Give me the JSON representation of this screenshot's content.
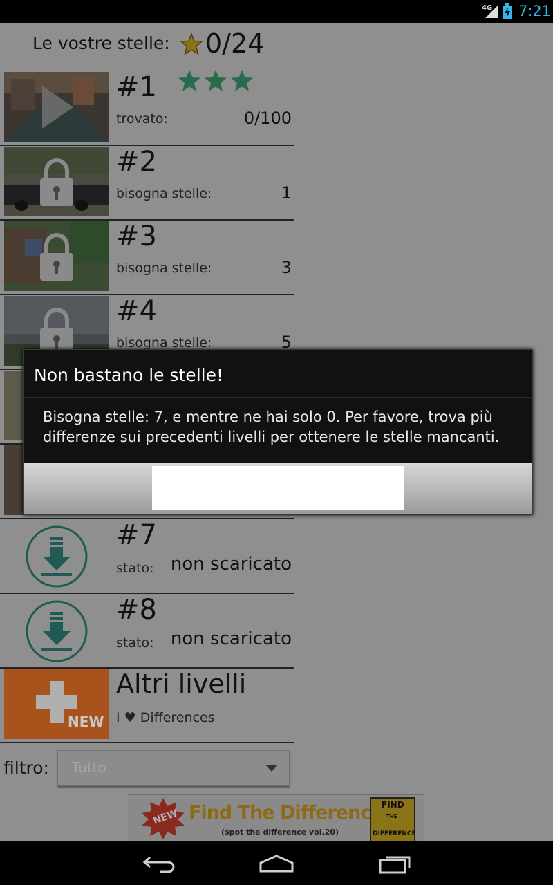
{
  "status_bar": {
    "network": "4G",
    "time": "7:21"
  },
  "header": {
    "label": "Le vostre stelle:",
    "count": "0/24"
  },
  "levels": [
    {
      "number": "#1",
      "key": "trovato:",
      "value": "0/100",
      "stars": 3,
      "state": "playable"
    },
    {
      "number": "#2",
      "key": "bisogna stelle:",
      "value": "1",
      "state": "locked"
    },
    {
      "number": "#3",
      "key": "bisogna stelle:",
      "value": "3",
      "state": "locked"
    },
    {
      "number": "#4",
      "key": "bisogna stelle:",
      "value": "5",
      "state": "locked"
    },
    {
      "number": "#7",
      "key": "stato:",
      "value": "non scaricato",
      "state": "download"
    },
    {
      "number": "#8",
      "key": "stato:",
      "value": "non scaricato",
      "state": "download"
    }
  ],
  "more_levels": {
    "title": "Altri livelli",
    "subtitle": "I ♥ Differences",
    "badge": "NEW"
  },
  "filter": {
    "label": "filtro:",
    "value": "Tutto"
  },
  "ad": {
    "badge": "NEW",
    "title": "Find The Difference",
    "subtitle": "(spot the difference vol.20)",
    "logo_line1": "FIND",
    "logo_line2": "THE",
    "logo_line3": "DIFFERENCE"
  },
  "dialog": {
    "title": "Non bastano le stelle!",
    "message": "Bisogna stelle: 7, e mentre ne hai solo 0. Per favore, trova più differenze sui precedenti livelli per ottenere le stelle mancanti.",
    "button_label": ""
  },
  "colors": {
    "accent_green": "#2a6b4c",
    "download_teal": "#1f5a55",
    "time_blue": "#33b5e5",
    "new_orange": "#a9531c"
  }
}
